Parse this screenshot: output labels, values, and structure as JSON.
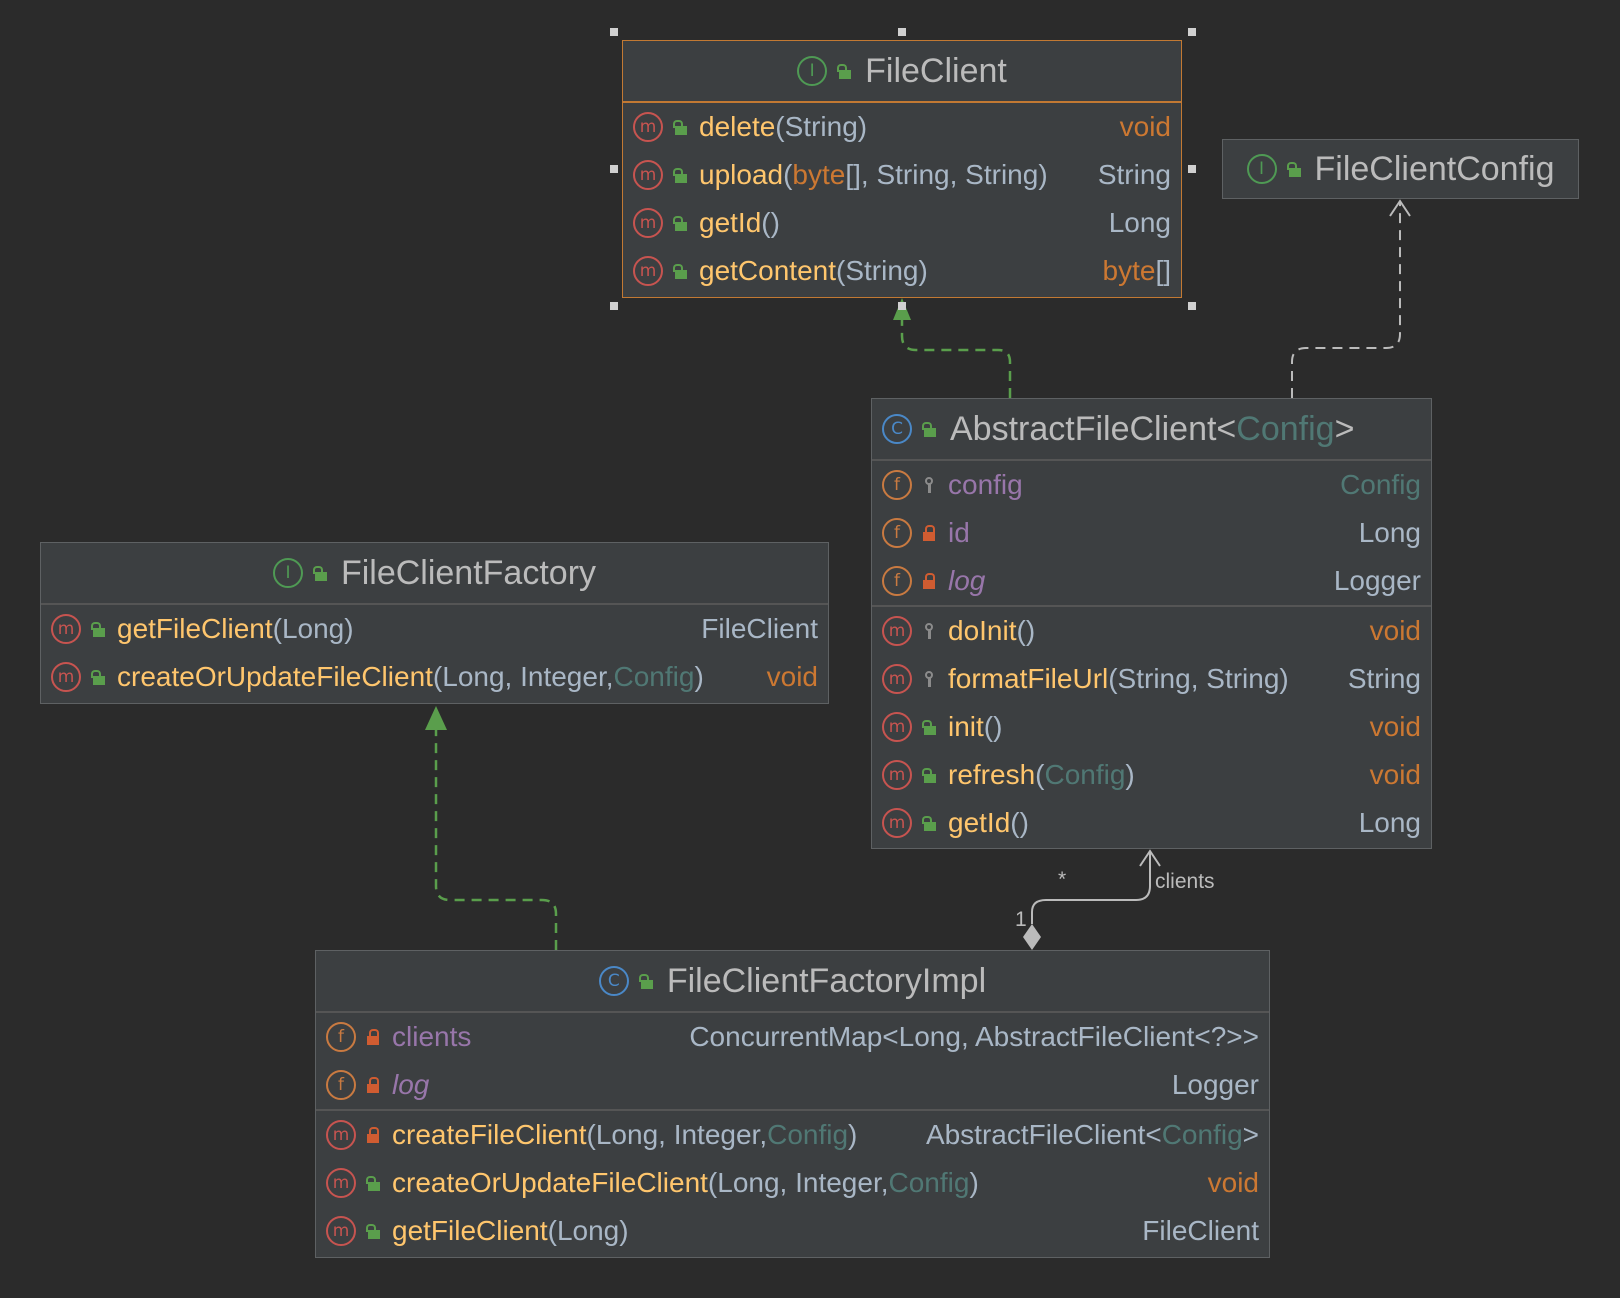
{
  "file_client": {
    "title": "FileClient",
    "header_icon": "interface-icon",
    "methods": [
      {
        "name": "delete",
        "params": "(String)",
        "ret": "void"
      },
      {
        "name": "upload",
        "p_open": "(",
        "p_kw": "byte",
        "p_rest": "[], String, String)",
        "ret": "String"
      },
      {
        "name": "getId",
        "params": " ()",
        "ret": "Long"
      },
      {
        "name": "getContent",
        "params": "(String)",
        "ret_kw": "byte",
        "ret_rest": "[]"
      }
    ]
  },
  "file_client_config": {
    "title": "FileClientConfig",
    "header_icon": "interface-icon"
  },
  "abstract_file_client": {
    "title": "AbstractFileClient<",
    "title_type": "Config",
    "title_close": ">",
    "header_icon": "class-icon",
    "fields": [
      {
        "name": "config",
        "ret": "Config",
        "visibility": "protected"
      },
      {
        "name": "id",
        "ret": "Long",
        "visibility": "private"
      },
      {
        "name": "log",
        "ret": "Logger",
        "visibility": "private"
      }
    ],
    "methods": [
      {
        "name": "doInit",
        "params": "()",
        "ret": "void",
        "visibility": "protected"
      },
      {
        "name": "formatFileUrl",
        "params": "(String, String)",
        "ret": "String",
        "visibility": "protected"
      },
      {
        "name": "init",
        "params": "()",
        "ret": "void",
        "visibility": "public"
      },
      {
        "name": "refresh",
        "p_open": "(",
        "p_type": "Config",
        "p_close": ")",
        "ret": "void",
        "visibility": "public"
      },
      {
        "name": "getId",
        "params": " ()",
        "ret": "Long",
        "visibility": "public"
      }
    ]
  },
  "file_client_factory": {
    "title": "FileClientFactory",
    "header_icon": "interface-icon",
    "methods": [
      {
        "name": "getFileClient",
        "params": "(Long)",
        "ret": "FileClient"
      },
      {
        "name": "createOrUpdateFileClient",
        "p_open": "(Long, Integer, ",
        "p_type": "Config",
        "p_close": ")",
        "ret": "void"
      }
    ]
  },
  "file_client_factory_impl": {
    "title": "FileClientFactoryImpl",
    "header_icon": "class-icon",
    "fields": [
      {
        "name": "clients",
        "ret": "ConcurrentMap<Long, AbstractFileClient<?>>"
      },
      {
        "name": "log",
        "ret": "Logger"
      }
    ],
    "methods": [
      {
        "name": "createFileClient",
        "p_open": "(Long, Integer, ",
        "p_type": "Config",
        "p_close": ")",
        "ret_a": "AbstractFileClient<",
        "ret_t": "Config",
        "ret_b": ">",
        "visibility": "private"
      },
      {
        "name": "createOrUpdateFileClient",
        "p_open": "(Long, Integer, ",
        "p_type": "Config",
        "p_close": ")",
        "ret": "void",
        "visibility": "public"
      },
      {
        "name": "getFileClient",
        "params": "(Long)",
        "ret": "FileClient",
        "visibility": "public"
      }
    ]
  },
  "relations": {
    "clients_label": "clients",
    "mult_many": "*",
    "mult_one": "1"
  },
  "colors": {
    "background": "#2b2b2b",
    "box": "#3c3f41",
    "selected_border": "#c27933",
    "implements_edge": "#5a9e4c",
    "dependency_edge": "#bbbbbb"
  }
}
